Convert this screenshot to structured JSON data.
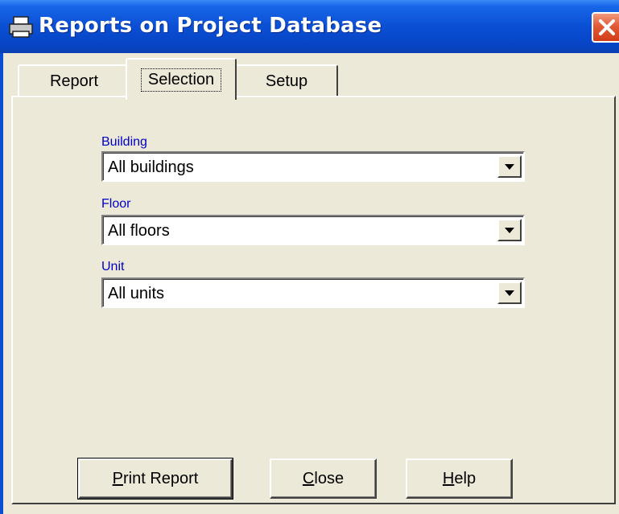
{
  "window": {
    "title": "Reports on Project Database",
    "close_label": "X"
  },
  "tabs": [
    {
      "label": "Report",
      "selected": false
    },
    {
      "label": "Selection",
      "selected": true
    },
    {
      "label": "Setup",
      "selected": false
    }
  ],
  "fields": {
    "building": {
      "label": "Building",
      "value": "All buildings"
    },
    "floor": {
      "label": "Floor",
      "value": "All floors"
    },
    "unit": {
      "label": "Unit",
      "value": "All units"
    }
  },
  "buttons": {
    "print": {
      "mnemonic": "P",
      "rest": "rint Report"
    },
    "close": {
      "mnemonic": "C",
      "rest": "lose"
    },
    "help": {
      "mnemonic": "H",
      "rest": "elp"
    }
  },
  "colors": {
    "titlebar": "#0a4fd4",
    "window_bg": "#ece9d8",
    "label_blue": "#0000c8",
    "close_red": "#e35a36"
  },
  "icons": {
    "title": "printer-icon",
    "close": "close-icon",
    "dropdown": "dropdown-arrow-icon"
  }
}
